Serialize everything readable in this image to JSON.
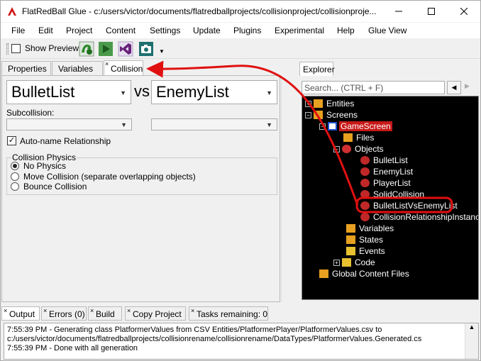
{
  "window": {
    "title": "FlatRedBall Glue - c:/users/victor/documents/flatredballprojects/collisionproject/collisionproje..."
  },
  "menu": [
    "File",
    "Edit",
    "Project",
    "Content",
    "Settings",
    "Update",
    "Plugins",
    "Experimental",
    "Help",
    "Glue View"
  ],
  "toolbar": {
    "show_preview_label": "Show Preview",
    "show_preview_checked": false,
    "icons": [
      "glue-run-icon",
      "play-icon",
      "visual-studio-icon",
      "camera-icon"
    ]
  },
  "left_tabs": {
    "properties": "Properties",
    "variables": "Variables",
    "collision": "Collision",
    "close_glyph": "×"
  },
  "collision": {
    "first_collection": "BulletList",
    "vs_label": "vs",
    "second_collection": "EnemyList",
    "subcollision_label": "Subcollision:",
    "subcollision_first": "",
    "subcollision_second": "",
    "auto_name_label": "Auto-name Relationship",
    "auto_name_checked": true,
    "physics_group_label": "Collision Physics",
    "physics_options": [
      {
        "label": "No Physics",
        "selected": true
      },
      {
        "label": "Move Collision (separate overlapping objects)",
        "selected": false
      },
      {
        "label": "Bounce Collision",
        "selected": false
      }
    ]
  },
  "explorer": {
    "tab_label": "Explorer",
    "search_placeholder": "Search... (CTRL + F)",
    "tree": [
      {
        "label": "Entities",
        "expander": "+",
        "icon": "folder-icon"
      },
      {
        "label": "Screens",
        "expander": "−",
        "icon": "folder-icon"
      },
      {
        "label": "GameScreen",
        "expander": "−",
        "icon": "screen-icon",
        "selected": true
      },
      {
        "label": "Files",
        "expander": "",
        "icon": "folder-icon"
      },
      {
        "label": "Objects",
        "expander": "−",
        "icon": "objects-icon"
      },
      {
        "label": "BulletList",
        "expander": "",
        "icon": "object-icon"
      },
      {
        "label": "EnemyList",
        "expander": "",
        "icon": "object-icon"
      },
      {
        "label": "PlayerList",
        "expander": "",
        "icon": "object-icon"
      },
      {
        "label": "SolidCollision",
        "expander": "",
        "icon": "object-icon"
      },
      {
        "label": "BulletListVsEnemyList",
        "expander": "",
        "icon": "object-icon",
        "highlighted": true
      },
      {
        "label": "CollisionRelationshipInstance",
        "expander": "",
        "icon": "object-icon"
      },
      {
        "label": "Variables",
        "expander": "",
        "icon": "folder-icon"
      },
      {
        "label": "States",
        "expander": "",
        "icon": "folder-icon"
      },
      {
        "label": "Events",
        "expander": "",
        "icon": "events-icon"
      },
      {
        "label": "Code",
        "expander": "+",
        "icon": "code-icon"
      },
      {
        "label": "Global Content Files",
        "expander": "",
        "icon": "folder-icon"
      }
    ]
  },
  "bottom_tabs": {
    "output": "Output",
    "errors": "Errors (0)",
    "build": "Build",
    "copy_project": "Copy Project",
    "tasks": "Tasks remaining: 0"
  },
  "output_lines": [
    "7:55:39 PM - Generating class PlatformerValues from CSV Entities/PlatformerPlayer/PlatformerValues.csv to",
    "c:/users/victor/documents/flatredballprojects/collisionrename/collisionrename/DataTypes/PlatformerValues.Generated.cs",
    "7:55:39 PM - Done with all generation"
  ],
  "colors": {
    "accent_red": "#e01010",
    "selection_red": "#c81818",
    "tree_background": "#000000"
  }
}
